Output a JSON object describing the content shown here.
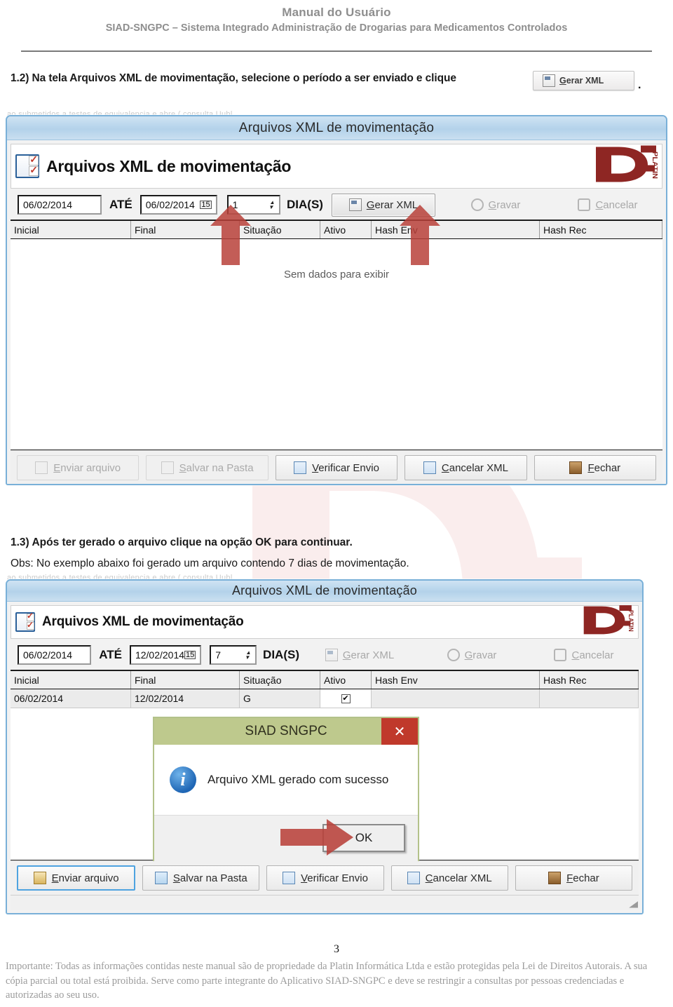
{
  "document": {
    "header_line1": "Manual do Usuário",
    "header_line2": "SIAD-SNGPC – Sistema Integrado Administração de Drogarias para Medicamentos Controlados",
    "page_number": "3",
    "footer_text": "Importante: Todas as informações contidas neste manual são de propriedade da Platin Informática Ltda e estão protegidas pela Lei de Direitos Autorais. A sua cópia parcial ou total está proibida. Serve como parte integrante do Aplicativo SIAD-SNGPC e deve se restringir a consultas por pessoas credenciadas e autorizadas ao seu uso.",
    "ghost_line": "ao submetidos a testes de equivalencia e abre ( consulta Uubl",
    "watermark_label": "PLATIN"
  },
  "steps": {
    "step1_number": "1.2)",
    "step1_text": "Na tela Arquivos XML de movimentação,  selecione o período a ser enviado  e clique",
    "step1_period": ".",
    "step2_number": "1.3)",
    "step2_text": "Após ter gerado o arquivo clique na opção OK para continuar.",
    "step2_obs": "Obs: No exemplo abaixo foi gerado um arquivo contendo 7 dias de movimentação.",
    "inline_button_label": "Gerar XML",
    "inline_button_accel": "G"
  },
  "screenshot1": {
    "window_title": "Arquivos XML de movimentação",
    "banner_title": "Arquivos XML de movimentação",
    "logo_text": "PLATIN",
    "toolbar": {
      "date_start": "06/02/2014",
      "ate_label": "ATÉ",
      "date_end": "06/02/2014",
      "calendar_glyph": "15",
      "days_value": "1",
      "days_label": "DIA(S)",
      "gerar_xml": "Gerar XML",
      "gerar_xml_accel": "G",
      "gravar": "Gravar",
      "gravar_accel": "G",
      "cancelar": "Cancelar",
      "cancelar_accel": "C"
    },
    "grid": {
      "columns": [
        "Inicial",
        "Final",
        "Situação",
        "Ativo",
        "Hash Env",
        "Hash Rec"
      ],
      "rows": [],
      "empty_message": "Sem dados para exibir"
    },
    "footer_buttons": [
      {
        "label": "Enviar arquivo",
        "accel": "E",
        "enabled": false
      },
      {
        "label": "Salvar na Pasta",
        "accel": "S",
        "enabled": false
      },
      {
        "label": "Verificar Envio",
        "accel": "V",
        "enabled": true
      },
      {
        "label": "Cancelar XML",
        "accel": "C",
        "enabled": true
      },
      {
        "label": "Fechar",
        "accel": "F",
        "enabled": true
      }
    ]
  },
  "screenshot2": {
    "window_title": "Arquivos XML de movimentação",
    "banner_title": "Arquivos XML de movimentação",
    "logo_text": "PLATIN",
    "toolbar": {
      "date_start": "06/02/2014",
      "ate_label": "ATÉ",
      "date_end": "12/02/2014",
      "calendar_glyph": "15",
      "days_value": "7",
      "days_label": "DIA(S)",
      "gerar_xml": "Gerar XML",
      "gerar_xml_accel": "G",
      "gravar": "Gravar",
      "gravar_accel": "G",
      "cancelar": "Cancelar",
      "cancelar_accel": "C"
    },
    "grid": {
      "columns": [
        "Inicial",
        "Final",
        "Situação",
        "Ativo",
        "Hash Env",
        "Hash Rec"
      ],
      "rows": [
        {
          "inicial": "06/02/2014",
          "final": "12/02/2014",
          "situacao": "G",
          "ativo": "✔",
          "hash_env": "",
          "hash_rec": ""
        }
      ]
    },
    "dialog": {
      "title": "SIAD SNGPC",
      "close_glyph": "✕",
      "icon": "info-icon",
      "message": "Arquivo XML gerado com sucesso",
      "ok_label": "OK"
    },
    "footer_buttons": [
      {
        "label": "Enviar arquivo",
        "accel": "E",
        "enabled": true
      },
      {
        "label": "Salvar na Pasta",
        "accel": "S",
        "enabled": true
      },
      {
        "label": "Verificar Envio",
        "accel": "V",
        "enabled": true
      },
      {
        "label": "Cancelar XML",
        "accel": "C",
        "enabled": true
      },
      {
        "label": "Fechar",
        "accel": "F",
        "enabled": true
      }
    ]
  },
  "annotations": {
    "arrow_color": "#b8413a",
    "arrow1_target": "calendar-picker",
    "arrow2_target": "gerar-xml-button",
    "arrow3_target": "ok-button"
  }
}
